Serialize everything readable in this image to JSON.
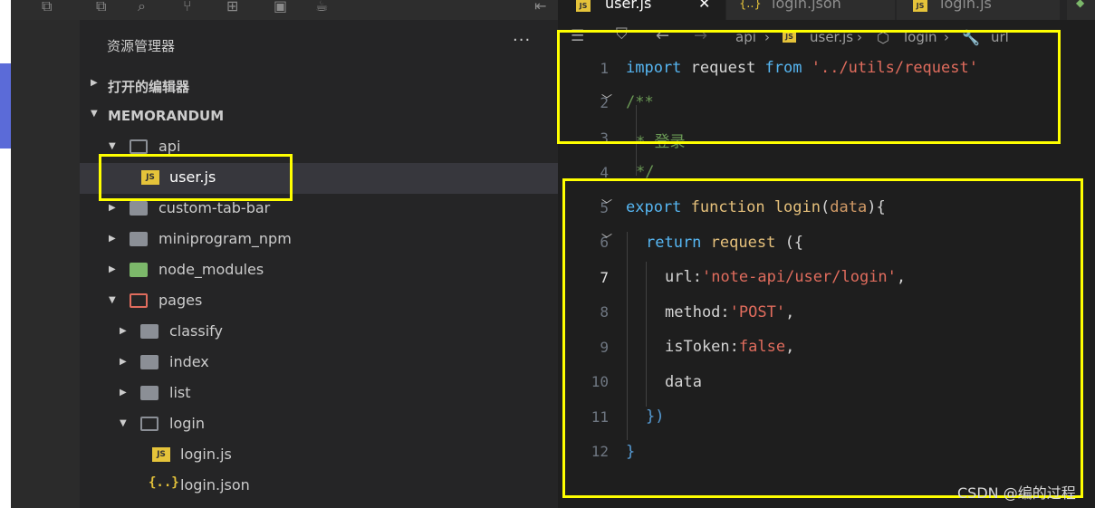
{
  "sidebar": {
    "title": "资源管理器",
    "more": "···",
    "sections": {
      "open_editors": "打开的编辑器",
      "project": "MEMORANDUM"
    },
    "tree": [
      {
        "label": "api"
      },
      {
        "label": "user.js"
      },
      {
        "label": "custom-tab-bar"
      },
      {
        "label": "miniprogram_npm"
      },
      {
        "label": "node_modules"
      },
      {
        "label": "pages"
      },
      {
        "label": "classify"
      },
      {
        "label": "index"
      },
      {
        "label": "list"
      },
      {
        "label": "login"
      },
      {
        "label": "login.js"
      },
      {
        "label": "login.json"
      }
    ]
  },
  "tabs": [
    {
      "label": "user.js",
      "badge": "JS"
    },
    {
      "label": "login.json",
      "badge": "{..}"
    },
    {
      "label": "login.js",
      "badge": "JS"
    }
  ],
  "breadcrumb": [
    "api",
    "user.js",
    "login",
    "url"
  ],
  "code": {
    "line_numbers": [
      "1",
      "2",
      "3",
      "4",
      "5",
      "6",
      "7",
      "8",
      "9",
      "10",
      "11",
      "12"
    ],
    "lines": [
      [
        "import",
        " request ",
        "from",
        " '../utils/request'"
      ],
      [
        "/**"
      ],
      [
        "* 登录"
      ],
      [
        "*/"
      ],
      [
        "export",
        " ",
        "function",
        " ",
        "login",
        "(",
        "data",
        "){"
      ],
      [
        "return",
        " ",
        "request",
        " ({"
      ],
      [
        "url",
        ":",
        "'note-api/user/login'",
        ","
      ],
      [
        "method",
        ":",
        "'POST'",
        ","
      ],
      [
        "isToken",
        ":",
        "false",
        ","
      ],
      [
        "data"
      ],
      [
        "})"
      ],
      [
        "}"
      ]
    ]
  },
  "watermark": "CSDN @编的过程",
  "colors": {
    "highlight_box": "#ffff00",
    "keyword": "#56b6f2",
    "string": "#e06c5d",
    "comment": "#6a9955"
  }
}
